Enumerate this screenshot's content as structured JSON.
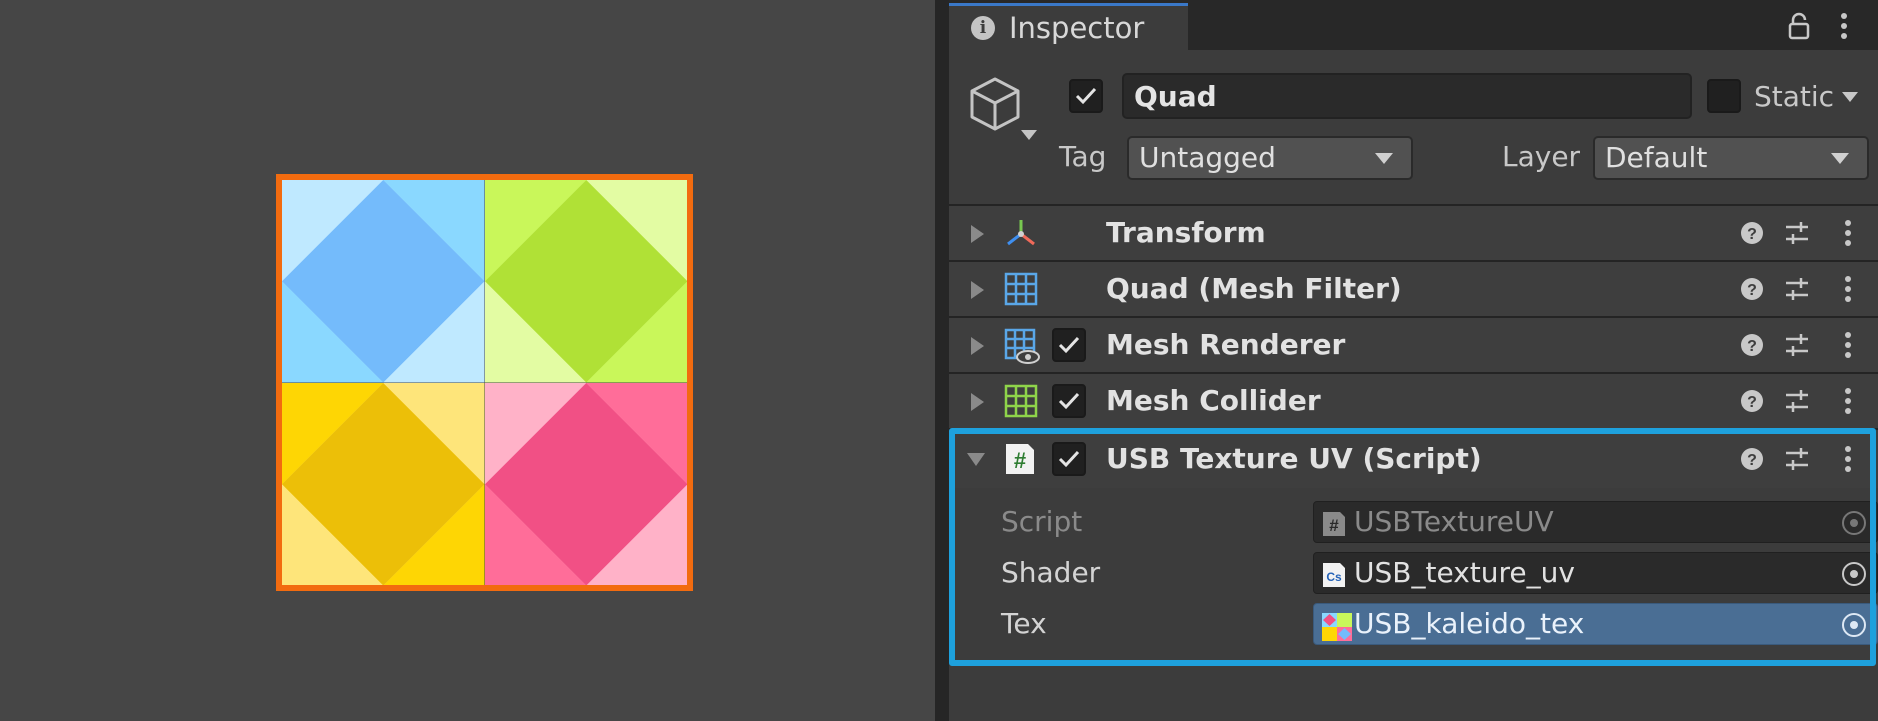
{
  "scene": {
    "selection_outline_color": "#f26b0f",
    "texture_tiles": [
      {
        "name": "blue",
        "bg": "#bfe9ff",
        "mid": "#8ad8ff",
        "diamond": "#74bbfb"
      },
      {
        "name": "green",
        "bg": "#e3fca3",
        "mid": "#c9f75a",
        "diamond": "#b0e136"
      },
      {
        "name": "yellow",
        "bg": "#fee57a",
        "mid": "#fed604",
        "diamond": "#ecbf08"
      },
      {
        "name": "pink",
        "bg": "#ffb2c8",
        "mid": "#ff6d99",
        "diamond": "#f15085"
      }
    ]
  },
  "inspector": {
    "tab_title": "Inspector",
    "tab_icon": "info-icon",
    "object": {
      "active": true,
      "name": "Quad",
      "static_label": "Static",
      "static_checked": false,
      "tag_label": "Tag",
      "tag_value": "Untagged",
      "layer_label": "Layer",
      "layer_value": "Default"
    },
    "components": [
      {
        "name": "Transform",
        "icon": "transform-icon",
        "has_checkbox": false,
        "expanded": false
      },
      {
        "name": "Quad (Mesh Filter)",
        "icon": "mesh-filter-icon",
        "has_checkbox": false,
        "expanded": false
      },
      {
        "name": "Mesh Renderer",
        "icon": "mesh-renderer-icon",
        "has_checkbox": true,
        "checked": true,
        "expanded": false
      },
      {
        "name": "Mesh Collider",
        "icon": "mesh-collider-icon",
        "has_checkbox": true,
        "checked": true,
        "expanded": false
      },
      {
        "name": "USB Texture UV (Script)",
        "icon": "script-hash-icon",
        "has_checkbox": true,
        "checked": true,
        "expanded": true
      }
    ],
    "script_properties": [
      {
        "label": "Script",
        "value": "USBTextureUV",
        "icon": "script-hash-icon",
        "disabled": true
      },
      {
        "label": "Shader",
        "value": "USB_texture_uv",
        "icon": "cs-file-icon",
        "disabled": false
      },
      {
        "label": "Tex",
        "value": "USB_kaleido_tex",
        "icon": "texture-thumb-icon",
        "disabled": false,
        "selected": true
      }
    ],
    "highlight_color": "#1ea1dd"
  }
}
